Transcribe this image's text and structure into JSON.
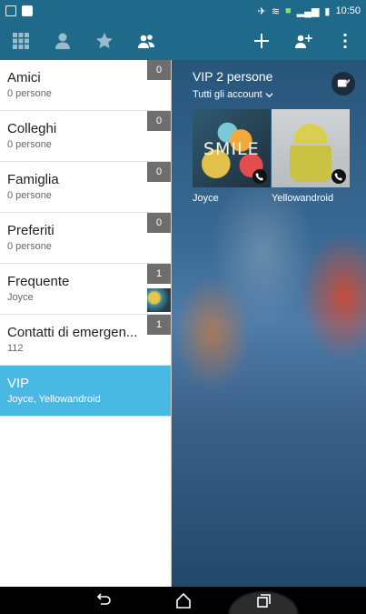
{
  "status_bar": {
    "time": "10:50"
  },
  "toolbar": {
    "tabs": [
      {
        "icon": "grid-icon",
        "active": false
      },
      {
        "icon": "person-icon",
        "active": false
      },
      {
        "icon": "star-icon",
        "active": false
      },
      {
        "icon": "group-icon",
        "active": true
      }
    ],
    "actions": [
      {
        "icon": "add-icon"
      },
      {
        "icon": "add-group-icon"
      },
      {
        "icon": "overflow-menu-icon"
      }
    ]
  },
  "groups": [
    {
      "name": "Amici",
      "subtitle": "0 persone",
      "count": "0",
      "selected": false
    },
    {
      "name": "Colleghi",
      "subtitle": "0 persone",
      "count": "0",
      "selected": false
    },
    {
      "name": "Famiglia",
      "subtitle": "0 persone",
      "count": "0",
      "selected": false
    },
    {
      "name": "Preferiti",
      "subtitle": "0 persone",
      "count": "0",
      "selected": false
    },
    {
      "name": "Frequente",
      "subtitle": "Joyce",
      "count": "1",
      "selected": false
    },
    {
      "name": "Contatti di emergen...",
      "subtitle": "112",
      "count": "1",
      "selected": false
    },
    {
      "name": "VIP",
      "subtitle": "Joyce, Yellowandroid",
      "count": "",
      "selected": true
    }
  ],
  "detail": {
    "title": "VIP 2 persone",
    "account_filter": "Tutti gli account",
    "edit_icon": "edit-group-icon",
    "members": [
      {
        "name": "Joyce",
        "photo_text": "SMILE"
      },
      {
        "name": "Yellowandroid",
        "photo_text": ""
      }
    ]
  },
  "nav": [
    {
      "icon": "back-icon"
    },
    {
      "icon": "home-icon"
    },
    {
      "icon": "recents-icon"
    }
  ],
  "colors": {
    "toolbar": "#1f6a8a",
    "selected_group": "#47b9e3",
    "count_badge": "#6e6e6e"
  }
}
